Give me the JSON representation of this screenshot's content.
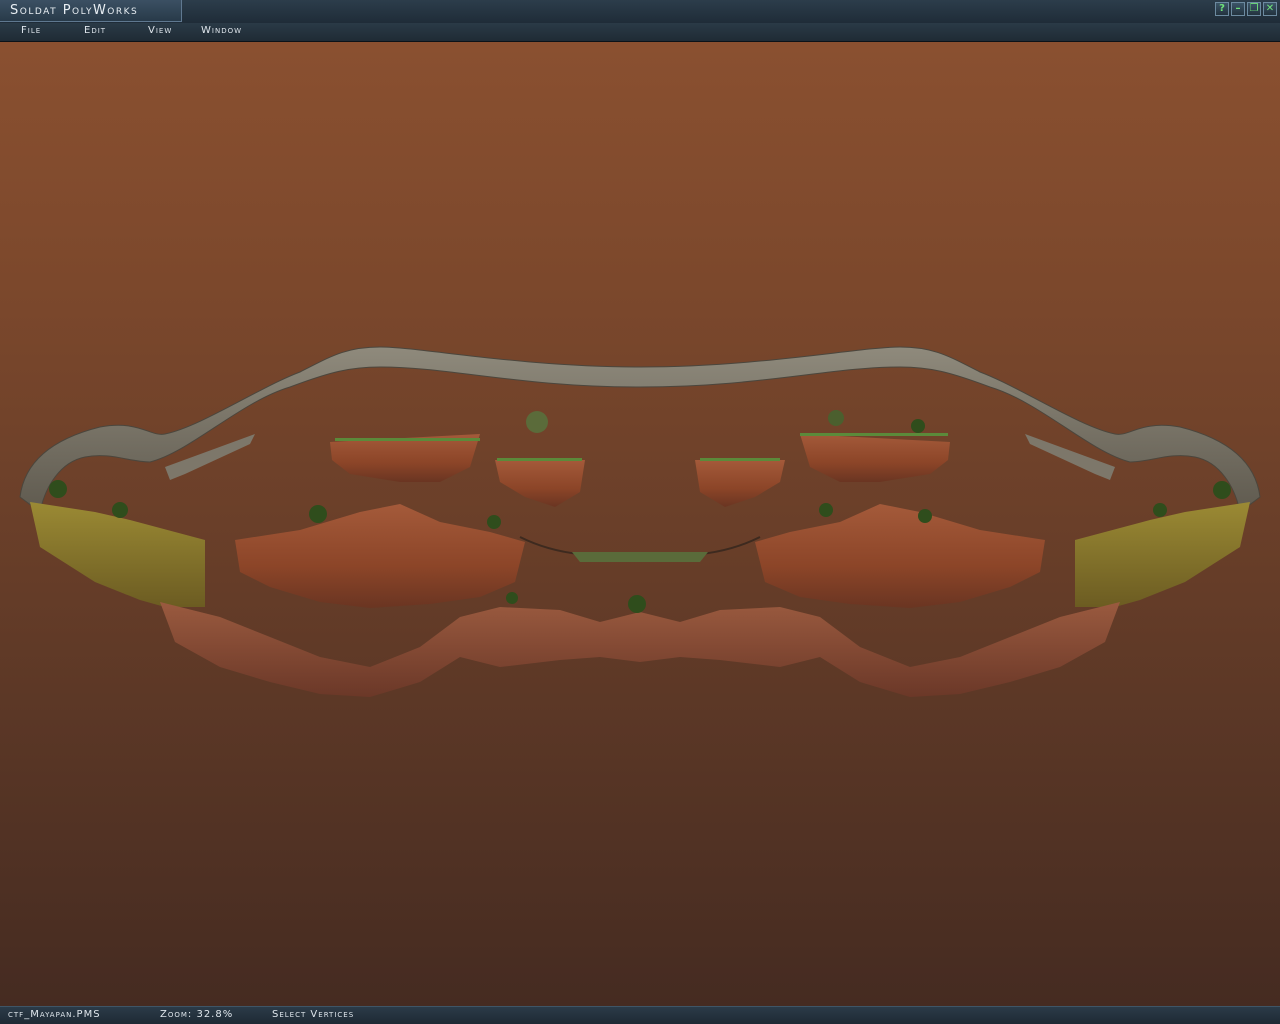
{
  "window": {
    "title": "Soldat PolyWorks",
    "buttons": [
      {
        "name": "help-button",
        "glyph": "?"
      },
      {
        "name": "minimize-button",
        "glyph": "–"
      },
      {
        "name": "restore-button",
        "glyph": "❐"
      },
      {
        "name": "close-button",
        "glyph": "✕"
      }
    ],
    "accent_color": "#6fe37a"
  },
  "menu": {
    "items": [
      "File",
      "Edit",
      "View",
      "Window"
    ]
  },
  "canvas": {
    "background_top": "#8a5030",
    "background_bottom": "#452b21",
    "rock_color": "#9a4e30",
    "stone_color": "#7d776a",
    "moss_color": "#8b7b2a"
  },
  "status": {
    "filename": "ctf_Mayapan.PMS",
    "zoom": "Zoom: 32.8%",
    "tool": "Select Vertices"
  }
}
